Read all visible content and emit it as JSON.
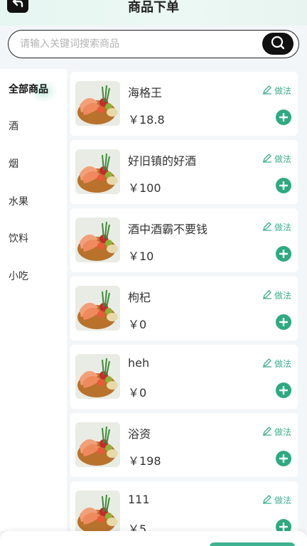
{
  "header": {
    "title": "商品下单",
    "back_icon": "back-arrow-icon"
  },
  "search": {
    "placeholder": "请输入关键词搜索商品",
    "value": "",
    "icon": "search-icon"
  },
  "sidebar": {
    "items": [
      {
        "label": "全部商品",
        "active": true
      },
      {
        "label": "酒",
        "active": false
      },
      {
        "label": "烟",
        "active": false
      },
      {
        "label": "水果",
        "active": false
      },
      {
        "label": "饮料",
        "active": false
      },
      {
        "label": "小吃",
        "active": false
      }
    ]
  },
  "products": [
    {
      "name": "海格王",
      "price": "￥18.8",
      "recipe_label": "做法"
    },
    {
      "name": "好旧镇的好酒",
      "price": "￥100",
      "recipe_label": "做法"
    },
    {
      "name": "酒中酒霸不要钱",
      "price": "￥10",
      "recipe_label": "做法"
    },
    {
      "name": "枸杞",
      "price": "￥0",
      "recipe_label": "做法"
    },
    {
      "name": "heh",
      "price": "￥0",
      "recipe_label": "做法"
    },
    {
      "name": "浴资",
      "price": "￥198",
      "recipe_label": "做法"
    },
    {
      "name": "111",
      "price": "￥5",
      "recipe_label": "做法"
    }
  ],
  "colors": {
    "accent": "#2faa80",
    "recipe_text": "#3fae8e",
    "background": "#f3f6f8"
  },
  "icons": {
    "edit": "edit-pencil-icon",
    "add": "plus-circle-icon"
  }
}
